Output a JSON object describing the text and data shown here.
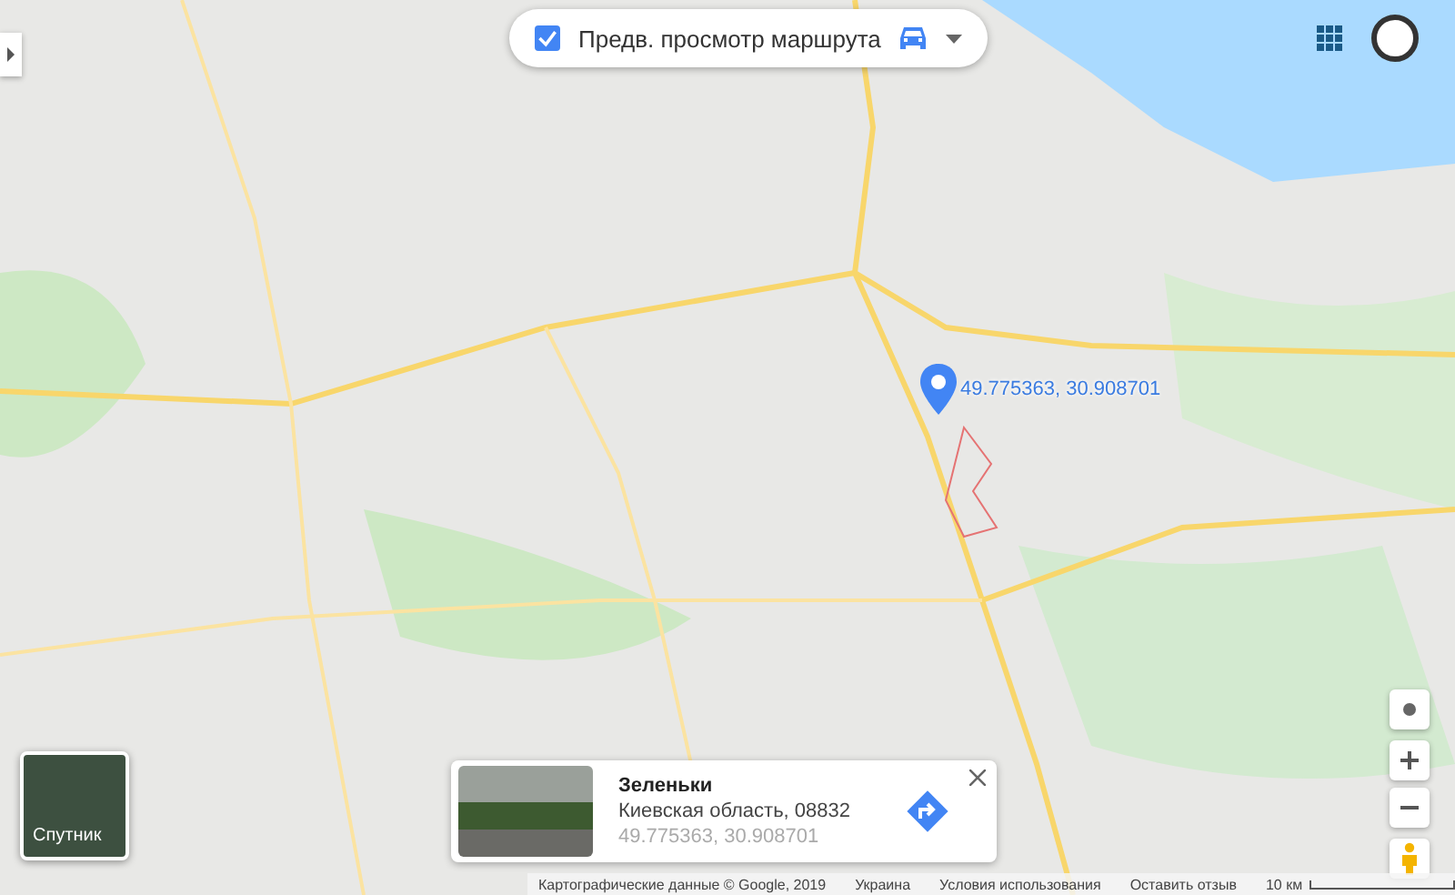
{
  "route_preview": {
    "label": "Предв. просмотр маршрута",
    "checked": true
  },
  "pin": {
    "coordinates": "49.775363, 30.908701"
  },
  "layer_switcher": {
    "label": "Спутник"
  },
  "place_card": {
    "title": "Зеленьки",
    "address": "Киевская область, 08832",
    "coordinates": "49.775363, 30.908701"
  },
  "footer": {
    "items": [
      "Картографические данные © Google, 2019",
      "Украина",
      "Условия использования",
      "Оставить отзыв"
    ],
    "scale": "10 км"
  }
}
